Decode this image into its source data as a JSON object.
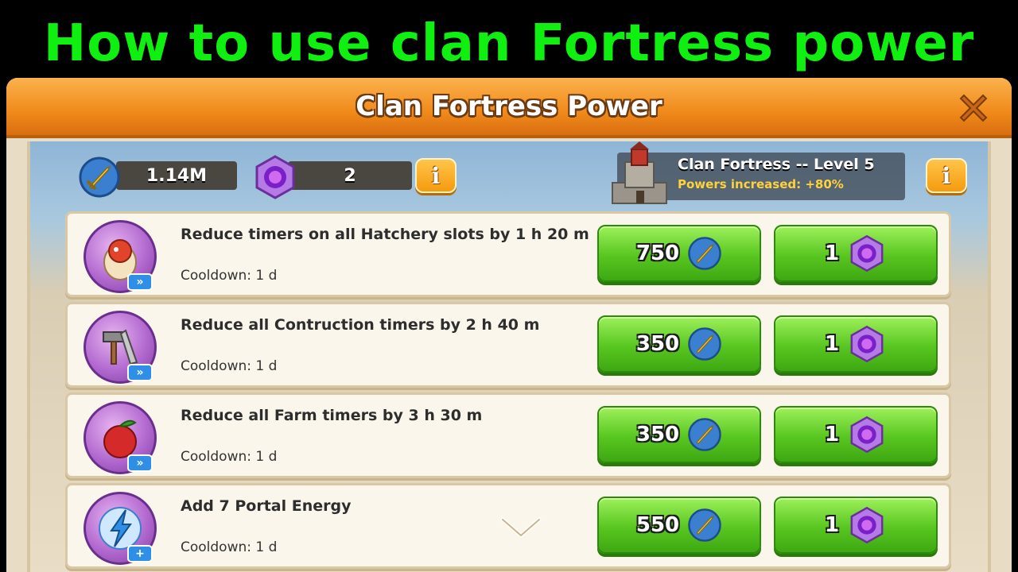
{
  "headline": "How to use clan Fortress power",
  "dialog": {
    "title": "Clan Fortress Power",
    "close_icon": "close-x-icon"
  },
  "resources": {
    "swords": {
      "value": "1.14M",
      "icon": "sword-icon"
    },
    "gems": {
      "value": "2",
      "icon": "purple-gem-icon"
    },
    "info_label": "i"
  },
  "fortress": {
    "name": "Clan Fortress -- Level 5",
    "boost": "Powers increased: +80%",
    "icon": "castle-icon",
    "info_label": "i"
  },
  "powers": [
    {
      "title": "Reduce timers on all Hatchery slots by 1 h 20 m",
      "cooldown": "Cooldown: 1 d",
      "sword_cost": "750",
      "gem_cost": "1",
      "icon": "dragon-egg-icon"
    },
    {
      "title": "Reduce all Contruction timers by 2 h 40 m",
      "cooldown": "Cooldown: 1 d",
      "sword_cost": "350",
      "gem_cost": "1",
      "icon": "hammer-saw-icon"
    },
    {
      "title": "Reduce all Farm timers by 3 h 30 m",
      "cooldown": "Cooldown: 1 d",
      "sword_cost": "350",
      "gem_cost": "1",
      "icon": "berry-icon"
    },
    {
      "title": "Add 7 Portal Energy",
      "cooldown": "Cooldown: 1 d",
      "sword_cost": "550",
      "gem_cost": "1",
      "icon": "lightning-icon"
    }
  ],
  "colors": {
    "headline": "#10f010",
    "header_orange": "#f08a1a",
    "button_green": "#58c620",
    "gem_purple": "#9b3fd0",
    "boost_yellow": "#ffd23a"
  }
}
